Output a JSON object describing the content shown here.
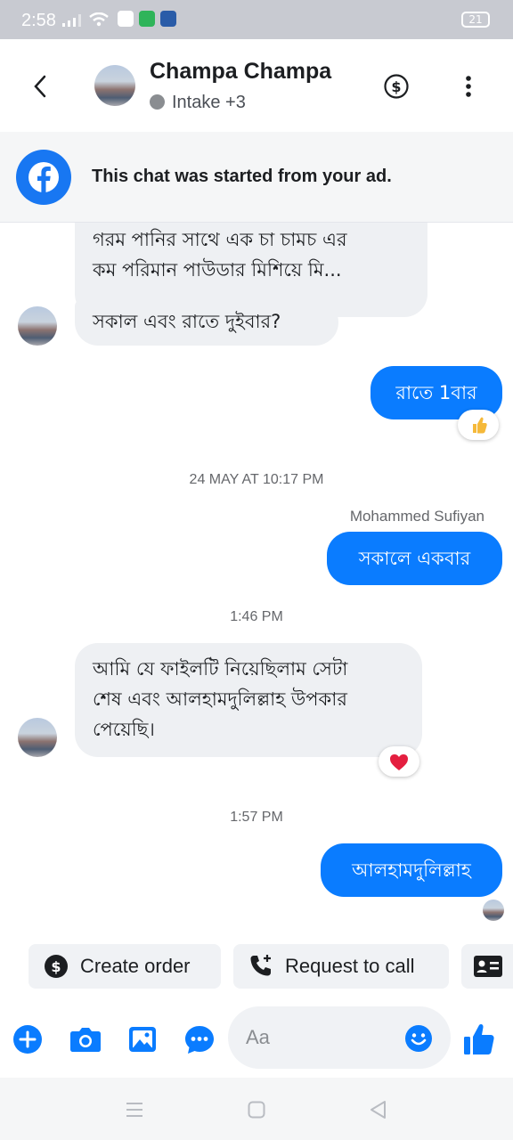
{
  "status_bar": {
    "time": "2:58",
    "battery": "21"
  },
  "header": {
    "contact_name": "Champa Champa",
    "subtitle": "Intake +3"
  },
  "banner": {
    "text": "This chat was started from your ad."
  },
  "messages": {
    "m1_line1": "গরম পানির সাথে  এক চা চামচ এর",
    "m1_line2": "কম পরিমান  পাউডার মিশিয়ে মি...",
    "m2": "সকাল এবং রাতে দুইবার?",
    "m3": "রাতে 1বার",
    "ts1": "24 MAY AT 10:17 PM",
    "sender": "Mohammed Sufiyan",
    "m4": "সকালে একবার",
    "ts2": "1:46 PM",
    "m5_line1": "আমি যে ফাইলটি নিয়েছিলাম সেটা",
    "m5_line2": "শেষ এবং আলহামদুলিল্লাহ উপকার",
    "m5_line3": "পেয়েছি।",
    "ts3": "1:57 PM",
    "m6": "আলহামদুলিল্লাহ"
  },
  "quick_actions": {
    "create_order": "Create order",
    "request_call": "Request to call"
  },
  "composer": {
    "placeholder": "Aa"
  },
  "colors": {
    "accent": "#0a7cff",
    "incoming_bubble": "#eef0f3",
    "facebook_blue": "#1877f2",
    "reaction_heart": "#e41e3f"
  }
}
